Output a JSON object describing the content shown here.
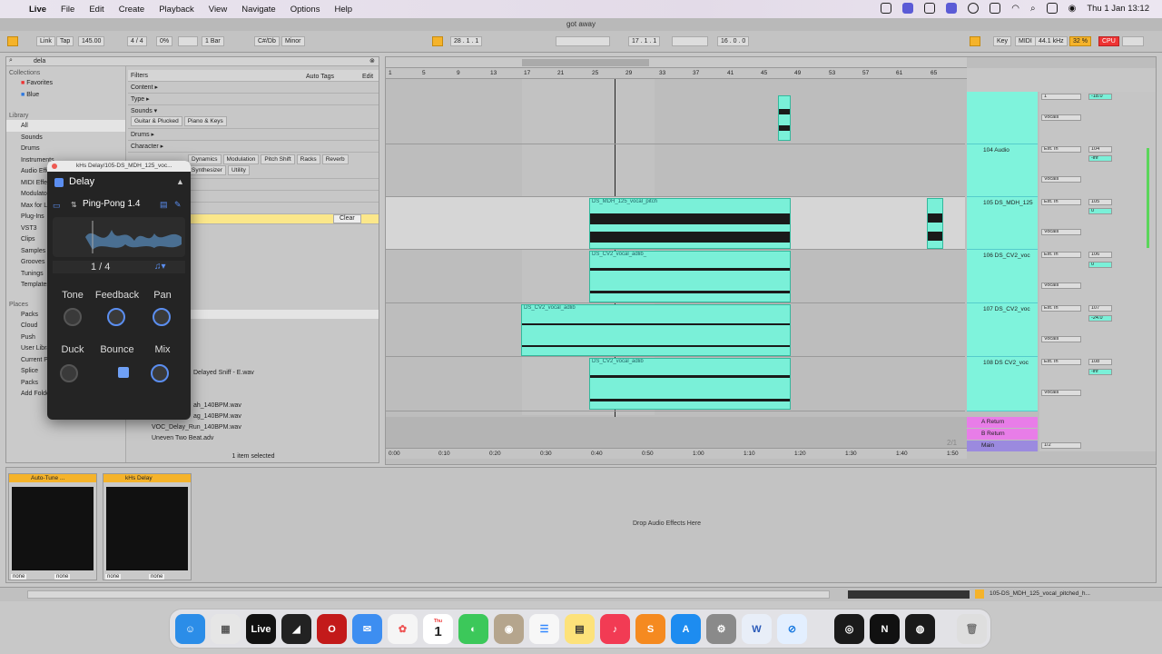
{
  "menubar": {
    "apple": "",
    "app": "Live",
    "items": [
      "File",
      "Edit",
      "Create",
      "Playback",
      "View",
      "Navigate",
      "Options",
      "Help"
    ],
    "clock": "Thu 1 Jan  13:12"
  },
  "window": {
    "title": "got away"
  },
  "control": {
    "link": "Link",
    "tap": "Tap",
    "tempo": "145.00",
    "sig": "4 / 4",
    "groove": "0%",
    "quant": "1 Bar",
    "key": "C#/Db",
    "scale": "Minor",
    "pos": "28 .  1 .  1",
    "loop_start": "17 .  1 .  1",
    "loop_len": "16 .  0 .  0",
    "key_label": "Key",
    "midi_label": "MIDI",
    "sample_rate": "44.1 kHz",
    "cpu_pct": "32 %",
    "cpu_label": "CPU"
  },
  "browser": {
    "search": "dela",
    "collections_header": "Collections",
    "favorites": "Favorites",
    "blue": "Blue",
    "library_header": "Library",
    "library": [
      "All",
      "Sounds",
      "Drums",
      "Instruments",
      "Audio Effects",
      "MIDI Effects",
      "Modulators",
      "Max for Live",
      "Plug-Ins",
      "VST3",
      "Clips",
      "Samples",
      "Grooves",
      "Tunings",
      "Templates"
    ],
    "places_header": "Places",
    "places": [
      "Packs",
      "Cloud",
      "Push",
      "User Library",
      "Current Project",
      "Splice",
      "Packs",
      "Add Folder..."
    ],
    "filters_label": "Filters",
    "auto_tags": "Auto Tags",
    "edit": "Edit",
    "filter_rows": [
      "Content ▸",
      "Type ▸",
      "Sounds ▾",
      "Drums ▸",
      "Character ▸"
    ],
    "sound_tags": [
      "Guitar & Plucked",
      "Piano & Keys"
    ],
    "fx_tags": [
      "Dynamics",
      "Modulation",
      "Pitch Shift",
      "Racks",
      "Reverb"
    ],
    "fx_tags2": [
      "Synthesizer",
      "Utility"
    ],
    "clear": "Clear",
    "files": [
      "Delayed Sniff - E.wav",
      "ah_140BPM.wav",
      "ag_140BPM.wav",
      "VOC_Delay_Run_140BPM.wav",
      "Uneven Two Beat.adv"
    ],
    "selected": "1 item selected"
  },
  "delay": {
    "window_title": "kHs Delay/105-DS_MDH_125_voc...",
    "name": "Delay",
    "preset": "Ping-Pong 1.4",
    "time": "1 / 4",
    "knobs_row1": [
      "Tone",
      "Feedback",
      "Pan"
    ],
    "knobs_row2": [
      "Duck",
      "Bounce",
      "Mix"
    ]
  },
  "arrangement": {
    "ruler": [
      "1",
      "5",
      "9",
      "13",
      "17",
      "21",
      "25",
      "29",
      "33",
      "37",
      "41",
      "45",
      "49",
      "53",
      "57",
      "61",
      "65"
    ],
    "timeline": [
      "0:00",
      "0:10",
      "0:20",
      "0:30",
      "0:40",
      "0:50",
      "1:00",
      "1:10",
      "1:20",
      "1:30",
      "1:40",
      "1:50"
    ],
    "clip_label_105": "DS_MDH_125_vocal_pitch",
    "clip_label_106": "DS_CV2_vocal_adlib_",
    "clip_label_107": "DS_CV2_vocal_adlib",
    "clip_label_108": "DS_CV2_vocal_adlib",
    "tracks": [
      {
        "name": "",
        "num": "",
        "input": "1",
        "monitor": "Auto",
        "out": "Vocals",
        "vol": "-18.0"
      },
      {
        "name": "104 Audio",
        "num": "104",
        "input": "Ext. In",
        "monitor": "Auto",
        "out": "Vocals",
        "vol": "-inf"
      },
      {
        "name": "105 DS_MDH_125",
        "num": "105",
        "input": "Ext. In",
        "monitor": "Auto",
        "out": "Vocals",
        "vol": "0"
      },
      {
        "name": "106 DS_CV2_voc",
        "num": "106",
        "input": "Ext. In",
        "monitor": "Auto",
        "out": "Vocals",
        "vol": "0"
      },
      {
        "name": "107 DS_CV2_voc",
        "num": "107",
        "input": "Ext. In",
        "monitor": "Auto",
        "out": "Vocals",
        "vol": "-24.0"
      },
      {
        "name": "108 DS CV2_voc",
        "num": "108",
        "input": "Ext. In",
        "monitor": "Auto",
        "out": "Vocals",
        "vol": "-inf"
      }
    ],
    "returns": [
      "A Return",
      "B Return"
    ],
    "main": "Main",
    "main_out": "1/2",
    "page": "2/1"
  },
  "devices": {
    "dev1": "Auto-Tune ...",
    "dev2": "kHs Delay",
    "none": "none",
    "drop_hint": "Drop Audio Effects Here"
  },
  "status": {
    "track_info": "105-DS_MDH_125_vocal_pitched_h..."
  },
  "dock": [
    "Finder",
    "Launchpad",
    "Live",
    "Linear",
    "Opera",
    "Mail",
    "Photos",
    "Calendar",
    "Messages",
    "Contacts",
    "Reminders",
    "Notes",
    "Music",
    "Sublime",
    "App Store",
    "System Settings",
    "Word",
    "Safari",
    "OBS",
    "Notion",
    "Controller",
    "Trash"
  ],
  "calendar_day": "1",
  "calendar_month": "Thu",
  "colors": {
    "accent": "#f5b32a",
    "clip": "#7af0d8",
    "return": "#e87de8",
    "main": "#9b8adf"
  }
}
